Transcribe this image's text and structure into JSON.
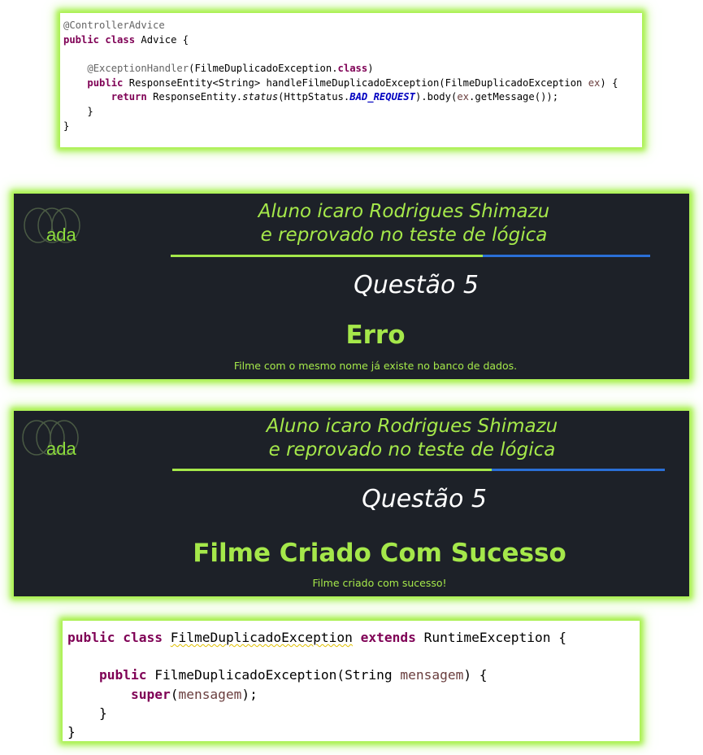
{
  "advice_code": {
    "annotation_class": "@ControllerAdvice",
    "kw_public": "public",
    "kw_class": "class",
    "class_decl": " Advice {",
    "annotation_method": "@ExceptionHandler",
    "annotation_arg": "(FilmeDuplicadoException.",
    "kw_class_lit": "class",
    "close_paren": ")",
    "method_sig": " ResponseEntity<String> handleFilmeDuplicadoException(FilmeDuplicadoException ",
    "param_ex": "ex",
    "method_sig_end": ") {",
    "kw_return": "return",
    "ret_part1": " ResponseEntity.",
    "ret_status": "status",
    "ret_part2": "(HttpStatus.",
    "ret_bad_request": "BAD_REQUEST",
    "ret_part3": ").body(",
    "ret_ex": "ex",
    "ret_part4": ".getMessage());",
    "close_method": "}",
    "close_class": "}"
  },
  "banners": [
    {
      "logo_text": "ada",
      "heading_line1": "Aluno icaro Rodrigues Shimazu",
      "heading_line2": "e reprovado no teste de lógica",
      "question": "Questão 5",
      "message": "Erro",
      "detail": "Filme com o mesmo nome já existe no banco de dados."
    },
    {
      "logo_text": "ada",
      "heading_line1": "Aluno icaro Rodrigues Shimazu",
      "heading_line2": "e reprovado no teste de lógica",
      "question": "Questão 5",
      "message": "Filme Criado Com Sucesso",
      "detail": "Filme criado com sucesso!"
    }
  ],
  "exception_code": {
    "kw_public": "public",
    "kw_class": "class",
    "class_name": "FilmeDuplicadoException",
    "kw_extends": "extends",
    "super_class": " RuntimeException {",
    "ctor_name": " FilmeDuplicadoException(String ",
    "param_mensagem": "mensagem",
    "ctor_end": ") {",
    "kw_super": "super",
    "super_open": "(",
    "super_arg": "mensagem",
    "super_close": ");",
    "close_ctor": "}",
    "close_class": "}"
  },
  "colors": {
    "glow": "#a8f04a",
    "banner_bg": "#1d2128",
    "accent_green": "#a5e84a",
    "accent_blue": "#2a6fd6",
    "keyword": "#7f0055",
    "annotation": "#646464",
    "static_field": "#0000c0",
    "parameter": "#6a3e3e"
  }
}
